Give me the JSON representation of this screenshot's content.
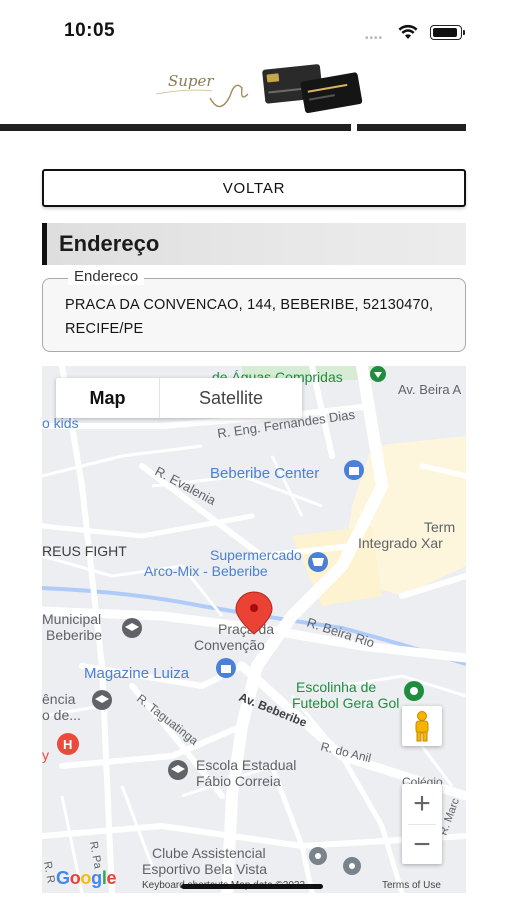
{
  "status_bar": {
    "time": "10:05"
  },
  "header": {
    "logo_text": "Super"
  },
  "back_button": {
    "label": "VOLTAR"
  },
  "section": {
    "title": "Endereço"
  },
  "address": {
    "legend": "Endereco",
    "value": "PRACA DA CONVENCAO, 144, BEBERIBE, 52130470, RECIFE/PE"
  },
  "map": {
    "tabs": [
      {
        "label": "Map",
        "selected": true
      },
      {
        "label": "Satellite",
        "selected": false
      }
    ],
    "labels": {
      "l_parque": "de Águas Compridas",
      "l_beira_a": "Av. Beira A",
      "l_kids": "o kids",
      "l_fernandes": "R. Eng. Fernandes Dias",
      "l_beberibe_center": "Beberibe Center",
      "l_evalenia": "R. Evalenia",
      "l_term1": "Term",
      "l_term2": "Integrado Xar",
      "l_fight": "REUS FIGHT",
      "l_super1": "Supermercado",
      "l_super2": "Arco-Mix - Beberibe",
      "l_muni1": "Municipal",
      "l_muni2": "Beberibe",
      "l_praca1": "Praça da",
      "l_praca2": "Convenção",
      "l_beira_rio": "R. Beira Rio",
      "l_magazine": "Magazine Luiza",
      "l_escolinha1": "Escolinha de",
      "l_escolinha2": "Futebol Gera Gol",
      "l_encia1": "ência",
      "l_encia2": "o de...",
      "l_taguatinga": "R. Taguatinga",
      "l_av_beberibe": "Av. Beberibe",
      "l_do_anil": "R. do Anil",
      "l_escola1": "Escola Estadual",
      "l_escola2": "Fábio Correia",
      "l_colegio": "Colégio",
      "l_clube1": "Clube Assistencial",
      "l_clube2": "Esportivo Bela Vista",
      "l_pa": "R. Pa",
      "l_r": "R. R",
      "l_marc": "R. Marc",
      "l_y": "y"
    },
    "zoom_in": "+",
    "zoom_out": "−",
    "google": "Google",
    "footer": "Keyboard shortcuts   Map data ©2023",
    "terms": "Terms of Use"
  },
  "colors": {
    "accent": "#111111",
    "pin": "#ea4335",
    "road_label": "#5f6368",
    "poi_blue": "#4a80d6",
    "poi_green": "#1e8e3e",
    "water": "#aecbfa"
  }
}
